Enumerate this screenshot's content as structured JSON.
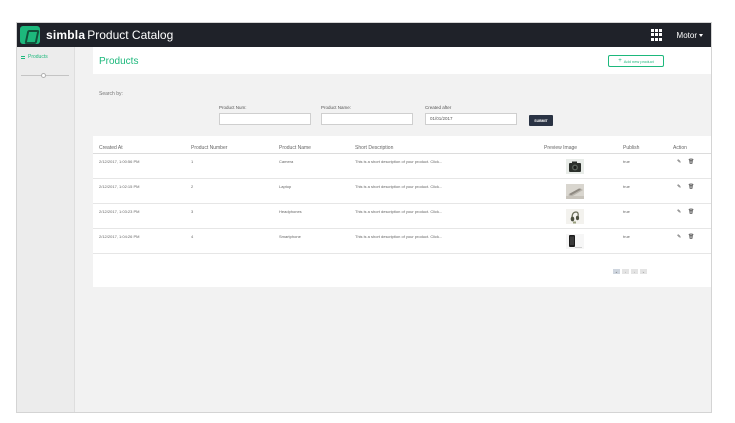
{
  "app": {
    "brand": "simbla",
    "title": "Product Catalog",
    "user": "Motor"
  },
  "sidebar": {
    "items": [
      {
        "label": "Products"
      }
    ]
  },
  "page": {
    "title": "Products",
    "add_button": "Add new product"
  },
  "search": {
    "label": "Search by:",
    "fields": [
      {
        "label": "Product Num:",
        "value": ""
      },
      {
        "label": "Product Name:",
        "value": ""
      },
      {
        "label": "Created after",
        "value": "01/01/2017"
      }
    ],
    "submit": "SUBMIT"
  },
  "table": {
    "columns": [
      "Created At",
      "Product Number",
      "Product Name",
      "Short Description",
      "Preview Image",
      "Publish",
      "Action"
    ],
    "rows": [
      {
        "created": "2/12/2017, 1:00:56 PM",
        "number": "1",
        "name": "Camera",
        "desc": "This is a short description of your product. Click...",
        "publish": "true",
        "image": "camera-image"
      },
      {
        "created": "2/12/2017, 1:02:15 PM",
        "number": "2",
        "name": "Laptop",
        "desc": "This is a short description of your product. Click...",
        "publish": "true",
        "image": "laptop-image"
      },
      {
        "created": "2/12/2017, 1:03:23 PM",
        "number": "3",
        "name": "Headphones",
        "desc": "This is a short description of your product. Click...",
        "publish": "true",
        "image": "headphones-image"
      },
      {
        "created": "2/12/2017, 1:04:26 PM",
        "number": "4",
        "name": "Smartphone",
        "desc": "This is a short description of your product. Click...",
        "publish": "true",
        "image": "smartphone-image"
      }
    ]
  },
  "pager": {
    "buttons": [
      "«",
      "‹",
      "›",
      "»"
    ]
  },
  "colors": {
    "accent": "#1db87c",
    "topbar": "#1f2229",
    "submit": "#2a3344"
  }
}
